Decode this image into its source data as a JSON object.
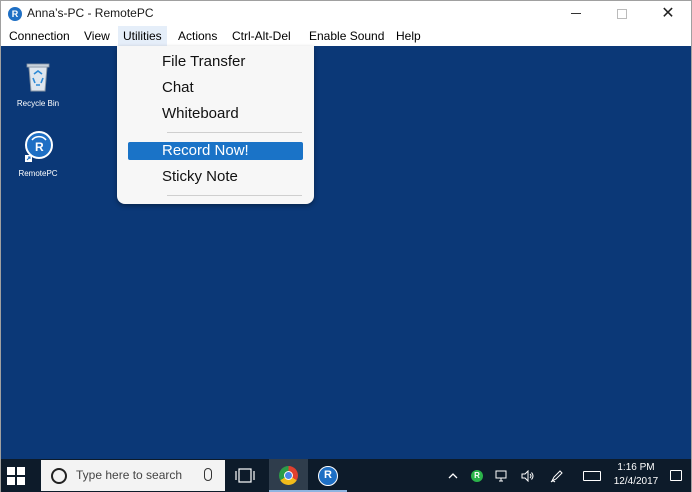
{
  "window": {
    "title": "Anna’s-PC - RemotePC",
    "app_icon_letter": "R"
  },
  "menubar": {
    "items": [
      "Connection",
      "View",
      "Utilities",
      "Actions",
      "Ctrl-Alt-Del",
      "Enable Sound",
      "Help"
    ],
    "active": "Utilities"
  },
  "utilities_menu": {
    "items": [
      "File Transfer",
      "Chat",
      "Whiteboard",
      "Record Now!",
      "Sticky Note"
    ],
    "highlighted": "Record Now!"
  },
  "desktop": {
    "background_color": "#0b3877",
    "icons": [
      {
        "label": "Recycle Bin",
        "icon": "recycle-bin-icon"
      },
      {
        "label": "RemotePC",
        "icon": "remotepc-icon"
      }
    ]
  },
  "taskbar": {
    "search_placeholder": "Type here to search",
    "remotepc_letter": "R",
    "tray_rpc_letter": "R",
    "clock_time": "1:16 PM",
    "clock_date": "12/4/2017"
  },
  "colors": {
    "accent": "#1a73c7",
    "taskbar": "#0d1b2a"
  }
}
